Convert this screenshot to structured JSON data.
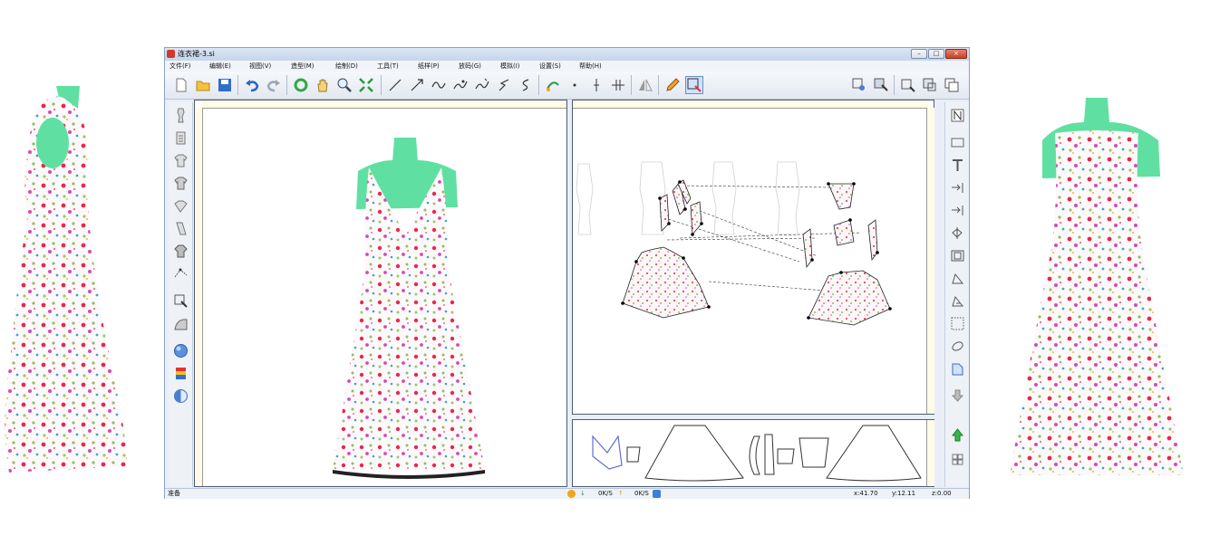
{
  "window": {
    "title": "连衣裙-3.si",
    "controls": {
      "minimize": "–",
      "maximize": "□",
      "close": "×"
    }
  },
  "menu": [
    "文件(F)",
    "编辑(E)",
    "视图(V)",
    "造型(M)",
    "绘制(D)",
    "工具(T)",
    "纸样(P)",
    "放码(G)",
    "模拟(I)",
    "设置(S)",
    "帮助(H)"
  ],
  "toolbar": {
    "icons": [
      "new-file-icon",
      "open-folder-icon",
      "save-icon",
      "undo-icon",
      "redo-icon",
      "rotate-view-icon",
      "pan-hand-icon",
      "zoom-icon",
      "fit-view-icon",
      "line-tool-icon",
      "arrow-line-icon",
      "curve-tool-icon",
      "curve-edit-icon",
      "curve-adjust-icon",
      "seam-tool-icon",
      "seam-curve-icon",
      "sewing-link-icon",
      "point-tool-icon",
      "notch-tool-icon",
      "cross-tool-icon",
      "mirror-tool-icon",
      "pencil-tool-icon",
      "select-piece-icon",
      "piece-move-icon",
      "piece-select-icon",
      "piece-arrange-icon",
      "piece-layer-icon",
      "piece-copy-icon"
    ]
  },
  "left_tools": [
    "mannequin-icon",
    "mannequin-list-icon",
    "shirt-icon",
    "shirt-back-icon",
    "collar-icon",
    "sleeve-icon",
    "garment-icon",
    "select-points-icon",
    "piece-edit-icon",
    "fabric-edge-icon",
    "material-sphere-icon",
    "color-gradient-icon",
    "half-sphere-icon"
  ],
  "right_tools": [
    "north-icon",
    "rectangle-icon",
    "text-icon",
    "right-arrow-bar-icon",
    "right-arrow-bar2-icon",
    "fold-line-icon",
    "frame-icon",
    "pattern-check-icon",
    "pattern-seam-icon",
    "dotted-frame-icon",
    "ellipse-tool-icon",
    "piece-import-icon",
    "download-icon",
    "upload-arrow-icon",
    "grid-icon"
  ],
  "status": {
    "left": "准备",
    "net_down": "0K/S",
    "net_up": "0K/S",
    "coord_x": "x:41.70",
    "coord_y": "y:12.11",
    "coord_z": "z:0.00"
  },
  "colors": {
    "title_bar": "#c5d5ea",
    "mannequin": "#5fe0a2",
    "panel_border": "#4c5c74",
    "ruler": "#fffbe6",
    "print_red": "#e8274a",
    "print_green": "#8fbf5a"
  }
}
